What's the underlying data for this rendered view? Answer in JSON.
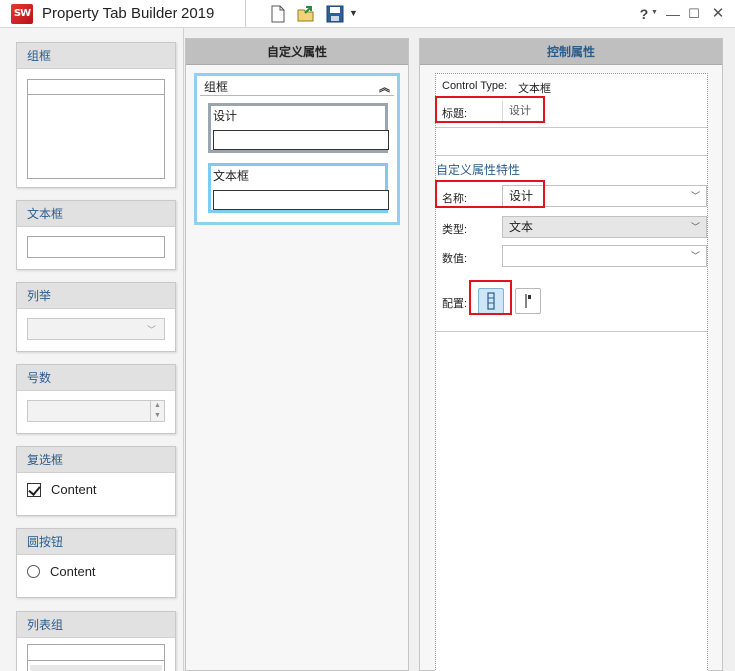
{
  "titlebar": {
    "logo_text": "SW",
    "title": "Property Tab Builder",
    "year": "2019",
    "help_glyph": "?",
    "icons": [
      "new-document-icon",
      "open-folder-icon",
      "save-icon",
      "dropdown-arrow-icon"
    ]
  },
  "palette": {
    "group_box": "组框",
    "text_box": "文本框",
    "list": "列举",
    "number": "号数",
    "checkbox": "复选框",
    "checkbox_text": "Content",
    "radio": "圆按钮",
    "radio_text": "Content",
    "list_group": "列表组"
  },
  "middle": {
    "header": "自定义属性",
    "group_title": "组框",
    "controls": [
      {
        "label": "设计"
      },
      {
        "label": "文本框"
      }
    ]
  },
  "right": {
    "header": "控制属性",
    "control_type_label": "Control Type:",
    "control_type_value": "文本框",
    "caption_label": "标题:",
    "caption_value": "设计",
    "section_title": "自定义属性特性",
    "name_label": "名称:",
    "name_value": "设计",
    "type_label": "类型:",
    "type_value": "文本",
    "value_label": "数值:",
    "value_value": "",
    "config_label": "配置:"
  },
  "colors": {
    "highlight_red": "#e3121b",
    "selection_blue": "#8fd0ee",
    "header_blue": "#2b5d8c"
  }
}
